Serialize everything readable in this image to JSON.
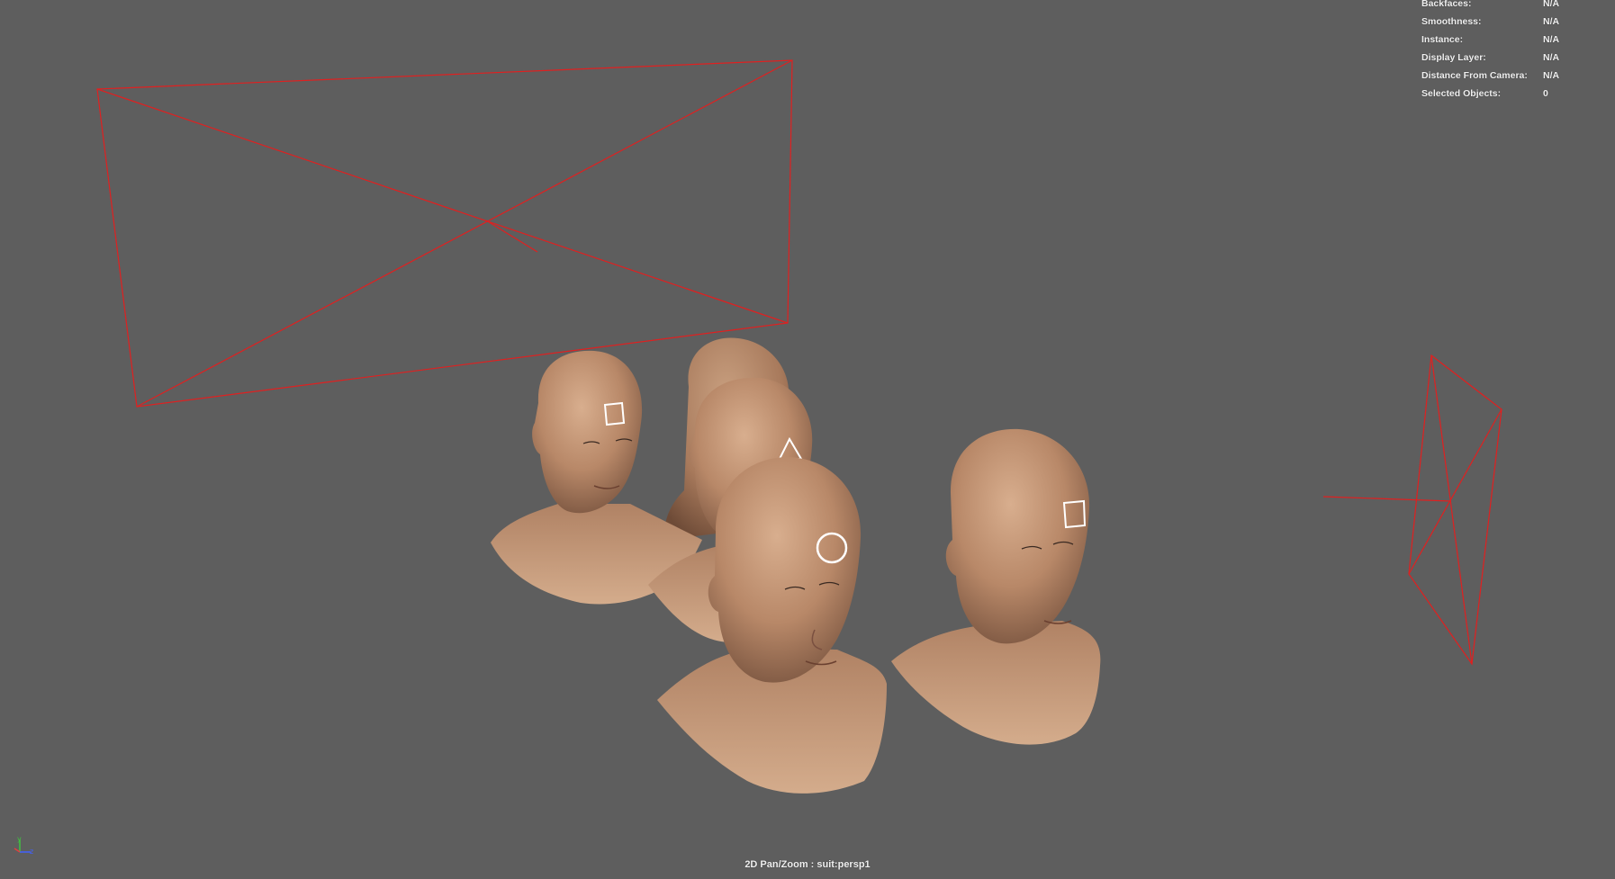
{
  "hud": {
    "rows": [
      {
        "label": "Backfaces:",
        "value": "N/A"
      },
      {
        "label": "Smoothness:",
        "value": "N/A"
      },
      {
        "label": "Instance:",
        "value": "N/A"
      },
      {
        "label": "Display Layer:",
        "value": "N/A"
      },
      {
        "label": "Distance From Camera:",
        "value": "N/A"
      },
      {
        "label": "Selected Objects:",
        "value": "0"
      }
    ]
  },
  "status_bar": {
    "text": "2D Pan/Zoom : suit:persp1"
  },
  "axis_gizmo": {
    "labels": [
      "y",
      "z"
    ]
  },
  "colors": {
    "viewport_bg": "#5e5e5e",
    "camera_wire": "#e02020",
    "hud_text": "#f0f0f0",
    "skin": "#c49878",
    "marker": "#ffffff"
  },
  "scene": {
    "heads": [
      {
        "name": "head-left",
        "marker": "square"
      },
      {
        "name": "head-back",
        "marker": "none"
      },
      {
        "name": "head-middle",
        "marker": "triangle"
      },
      {
        "name": "head-front",
        "marker": "circle"
      },
      {
        "name": "head-right",
        "marker": "square"
      }
    ],
    "cameras": [
      "camera-frustum-top-left",
      "camera-frustum-right"
    ]
  }
}
